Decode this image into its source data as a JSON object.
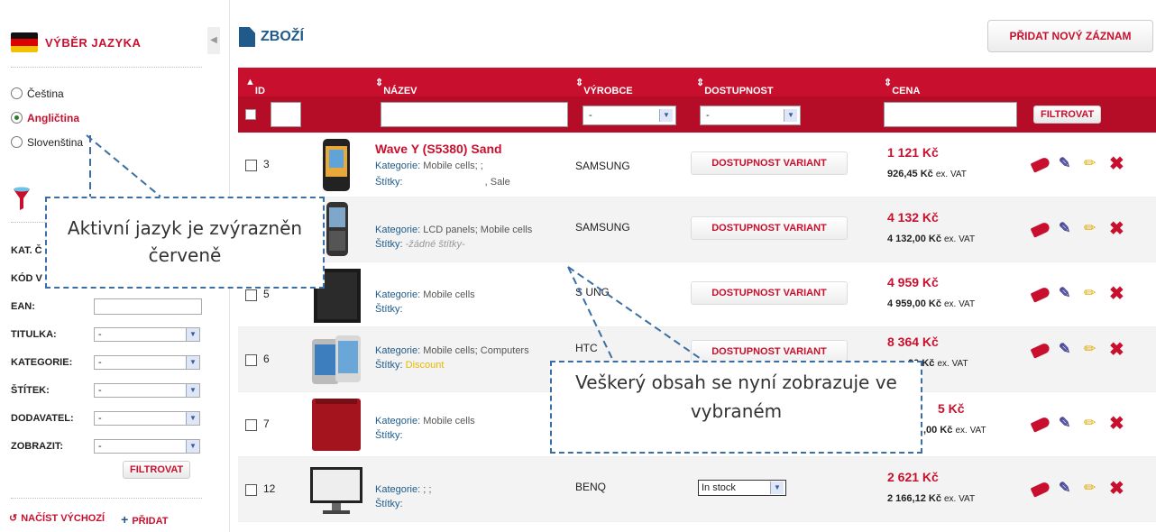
{
  "sidebar": {
    "language_title": "VÝBĚR JAZYKA",
    "languages": [
      {
        "label": "Čeština",
        "selected": false
      },
      {
        "label": "Angličtina",
        "selected": true
      },
      {
        "label": "Slovenština",
        "selected": false
      }
    ],
    "filter_fields": [
      {
        "label": "KAT. Č",
        "type": "text",
        "value": ""
      },
      {
        "label": "KÓD V",
        "type": "text",
        "value": ""
      },
      {
        "label": "EAN:",
        "type": "text",
        "value": ""
      },
      {
        "label": "TITULKA:",
        "type": "select",
        "value": "-"
      },
      {
        "label": "KATEGORIE:",
        "type": "select",
        "value": "-"
      },
      {
        "label": "ŠTÍTEK:",
        "type": "select",
        "value": "-"
      },
      {
        "label": "DODAVATEL:",
        "type": "select",
        "value": "-"
      },
      {
        "label": "ZOBRAZIT:",
        "type": "select",
        "value": "-"
      }
    ],
    "filter_button": "FILTROVAT",
    "load_default": "NAČÍST VÝCHOZÍ",
    "add": "PŘIDAT"
  },
  "main": {
    "title": "ZBOŽÍ",
    "add_button": "PŘIDAT NOVÝ ZÁZNAM",
    "columns": [
      "ID",
      "NÁZEV",
      "VÝROBCE",
      "DOSTUPNOST",
      "CENA"
    ],
    "filter_select_value": "-",
    "filter_button": "FILTROVAT",
    "category_label": "Kategorie:",
    "tags_label": "Štítky:",
    "vat_suffix": "ex. VAT",
    "rows": [
      {
        "id": "3",
        "name": "Wave Y (S5380) Sand",
        "categories": "Mobile cells; ;",
        "tags": ", Sale",
        "maker": "SAMSUNG",
        "availability": "DOSTUPNOST VARIANT",
        "price": "1 121 Kč",
        "price_ex": "926,45 Kč"
      },
      {
        "id": "",
        "name": "",
        "categories": "LCD panels; Mobile cells",
        "tags": "-žádné štítky-",
        "maker": "SAMSUNG",
        "availability": "DOSTUPNOST VARIANT",
        "price": "4 132 Kč",
        "price_ex": "4 132,00 Kč"
      },
      {
        "id": "5",
        "name": "",
        "categories": "Mobile cells",
        "tags": "",
        "maker": "S      UNG",
        "availability": "DOSTUPNOST VARIANT",
        "price": "4 959 Kč",
        "price_ex": "4 959,00 Kč"
      },
      {
        "id": "6",
        "name": "",
        "categories": "Mobile cells; Computers",
        "tags": "Discount",
        "maker": "HTC",
        "availability": "DOSTUPNOST VARIANT",
        "price": "8 364 Kč",
        "price_ex": ",00 Kč"
      },
      {
        "id": "7",
        "name": "",
        "categories": "Mobile cells",
        "tags": "",
        "maker": "",
        "availability": "",
        "price": "5 Kč",
        "price_ex": ",00 Kč"
      },
      {
        "id": "12",
        "name": "",
        "categories": "; ;",
        "tags": "",
        "maker": "BENQ",
        "availability_select": "In stock",
        "price": "2 621 Kč",
        "price_ex": "2 166,12 Kč"
      }
    ]
  },
  "callouts": {
    "language": "Aktivní jazyk je zvýrazněn červeně",
    "content": "Veškerý obsah se nyní zobrazuje ve vybraném"
  },
  "colors": {
    "accent": "#c8102e",
    "callout_border": "#3b6ea5",
    "title_blue": "#1f5a8a"
  }
}
